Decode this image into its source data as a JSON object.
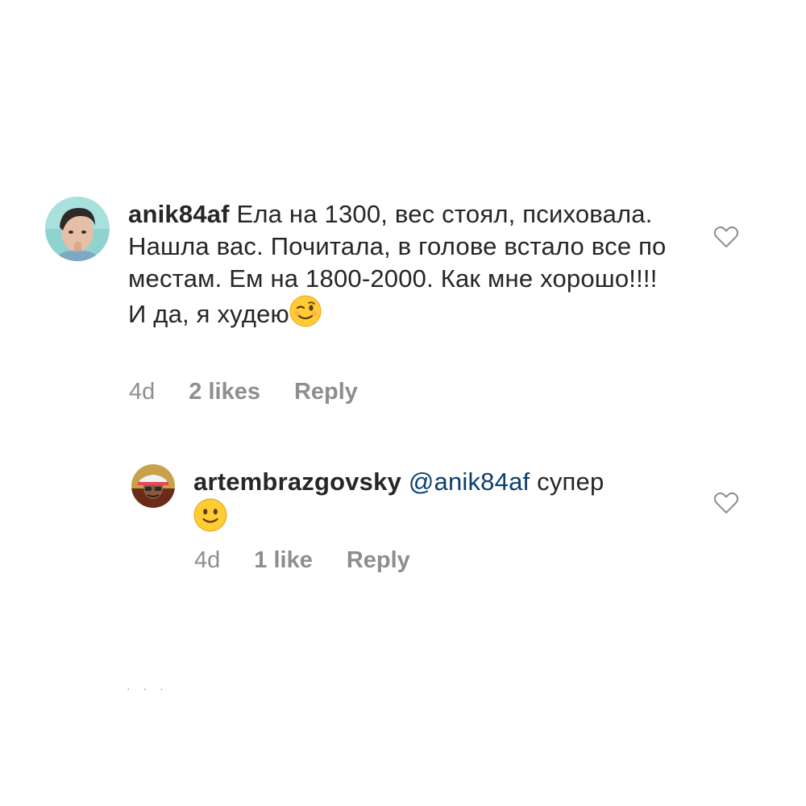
{
  "comments": [
    {
      "username": "anik84af",
      "text": "Ела на 1300, вес стоял, психовала. Нашла вас. Почитала, в голове встало все по местам. Ем на 1800-2000. Как мне хорошо!!!! И да, я худею",
      "emoji": "winking-face",
      "time": "4d",
      "likes": "2 likes",
      "reply": "Reply"
    },
    {
      "username": "artembrazgovsky",
      "mention": "@anik84af",
      "text": "супер",
      "emoji": "slightly-smiling-face",
      "time": "4d",
      "likes": "1 like",
      "reply": "Reply"
    }
  ],
  "more_indicator": "·  ·  ·",
  "colors": {
    "text": "#262626",
    "meta": "#8e8e8e",
    "mention": "#0c3f70",
    "heart": "#8e8e8e"
  }
}
